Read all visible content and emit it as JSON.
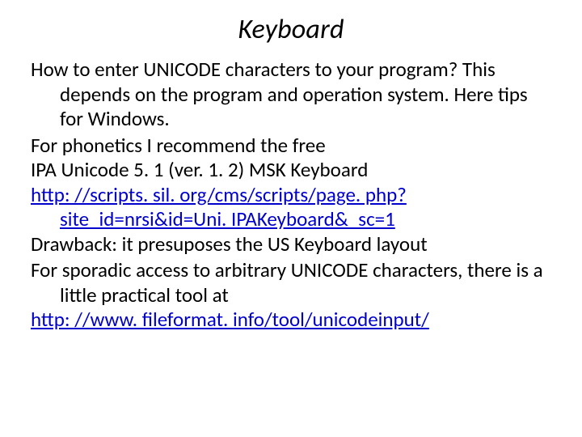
{
  "title": "Keyboard",
  "p1a": "How to enter UNICODE characters to your program? This depends on the program and operation system. Here tips for Windows.",
  "p2a": "For phonetics I recommend the free",
  "p2b": "IPA Unicode 5. 1 (ver. 1. 2) MSK Keyboard",
  "link1": "http: //scripts. sil. org/cms/scripts/page. php? site_id=nrsi&id=Uni. IPAKeyboard&_sc=1",
  "p2c": "Drawback: it presuposes the US Keyboard layout",
  "p3a": "For sporadic access to arbitrary UNICODE characters, there is a little practical tool at",
  "link2": "http: //www. fileformat. info/tool/unicodeinput/"
}
